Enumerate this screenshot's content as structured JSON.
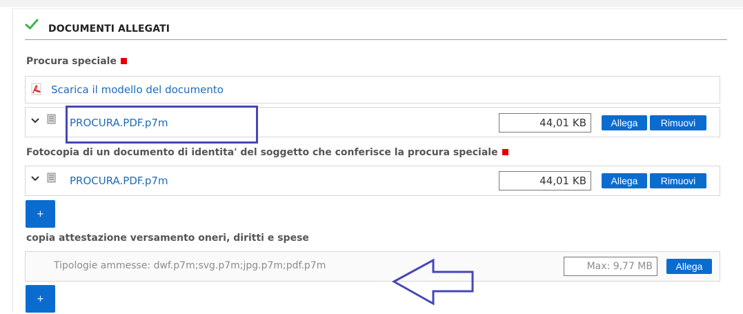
{
  "section": {
    "title": "DOCUMENTI ALLEGATI",
    "check_icon": "check-icon",
    "accent_color": "#0b6cd0",
    "required_color": "#e00000"
  },
  "procura": {
    "label": "Procura speciale",
    "template_link": "Scarica il modello del documento",
    "file": {
      "name": "PROCURA.PDF.p7m",
      "size": "44,01 KB",
      "attach_label": "Allega",
      "remove_label": "Rimuovi"
    }
  },
  "identita": {
    "label": "Fotocopia di un documento di identita' del soggetto che conferisce la procura speciale",
    "file": {
      "name": "PROCURA.PDF.p7m",
      "size": "44,01 KB",
      "attach_label": "Allega",
      "remove_label": "Rimuovi"
    },
    "add_label": "+"
  },
  "versamento": {
    "label": "copia attestazione versamento oneri, diritti e spese",
    "allowed_types": "Tipologie ammesse: dwf.p7m;svg.p7m;jpg.p7m;pdf.p7m",
    "max_size": "Max: 9,77 MB",
    "attach_label": "Allega",
    "add_label": "+"
  }
}
